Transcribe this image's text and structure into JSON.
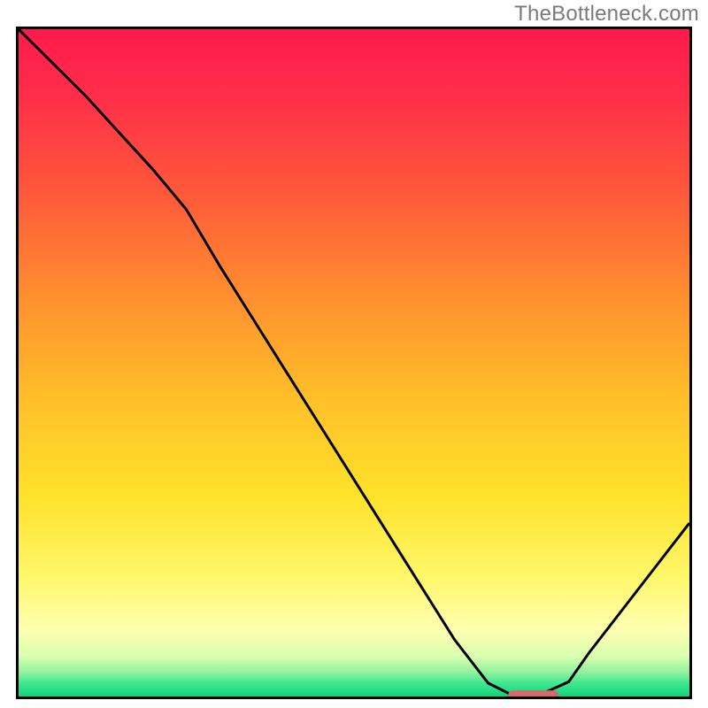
{
  "watermark": "TheBottleneck.com",
  "chart_data": {
    "type": "line",
    "title": "",
    "xlabel": "",
    "ylabel": "",
    "xlim": [
      0,
      100
    ],
    "ylim": [
      0,
      100
    ],
    "grid": false,
    "legend": false,
    "series": [
      {
        "name": "bottleneck-curve",
        "x": [
          0,
          5,
          10,
          15,
          20,
          25,
          30,
          35,
          40,
          45,
          50,
          55,
          60,
          65,
          70,
          73,
          75,
          78,
          82,
          85,
          90,
          95,
          100
        ],
        "y": [
          100,
          95,
          90,
          84.5,
          79,
          73,
          64.5,
          56.5,
          48.5,
          40.5,
          32.5,
          24.5,
          16.5,
          8.5,
          2,
          0.5,
          0,
          0.4,
          2.2,
          6.5,
          13,
          19.5,
          26
        ]
      }
    ],
    "marker": {
      "name": "optimal-marker",
      "x_from": 73,
      "x_to": 80.5,
      "y": 0,
      "color": "#d66a6a",
      "thickness_pct": 1.3
    },
    "background_gradient": {
      "stops": [
        {
          "offset": 0,
          "color": "#ff1a4d"
        },
        {
          "offset": 0.1,
          "color": "#ff2e4a"
        },
        {
          "offset": 0.25,
          "color": "#ff5a3a"
        },
        {
          "offset": 0.4,
          "color": "#ff8f2f"
        },
        {
          "offset": 0.55,
          "color": "#ffbe2a"
        },
        {
          "offset": 0.7,
          "color": "#ffe22a"
        },
        {
          "offset": 0.82,
          "color": "#fff76a"
        },
        {
          "offset": 0.9,
          "color": "#ffffb0"
        },
        {
          "offset": 0.94,
          "color": "#d9ffb0"
        },
        {
          "offset": 0.965,
          "color": "#8cf29c"
        },
        {
          "offset": 0.98,
          "color": "#40e890"
        },
        {
          "offset": 1.0,
          "color": "#10d47a"
        }
      ]
    }
  }
}
